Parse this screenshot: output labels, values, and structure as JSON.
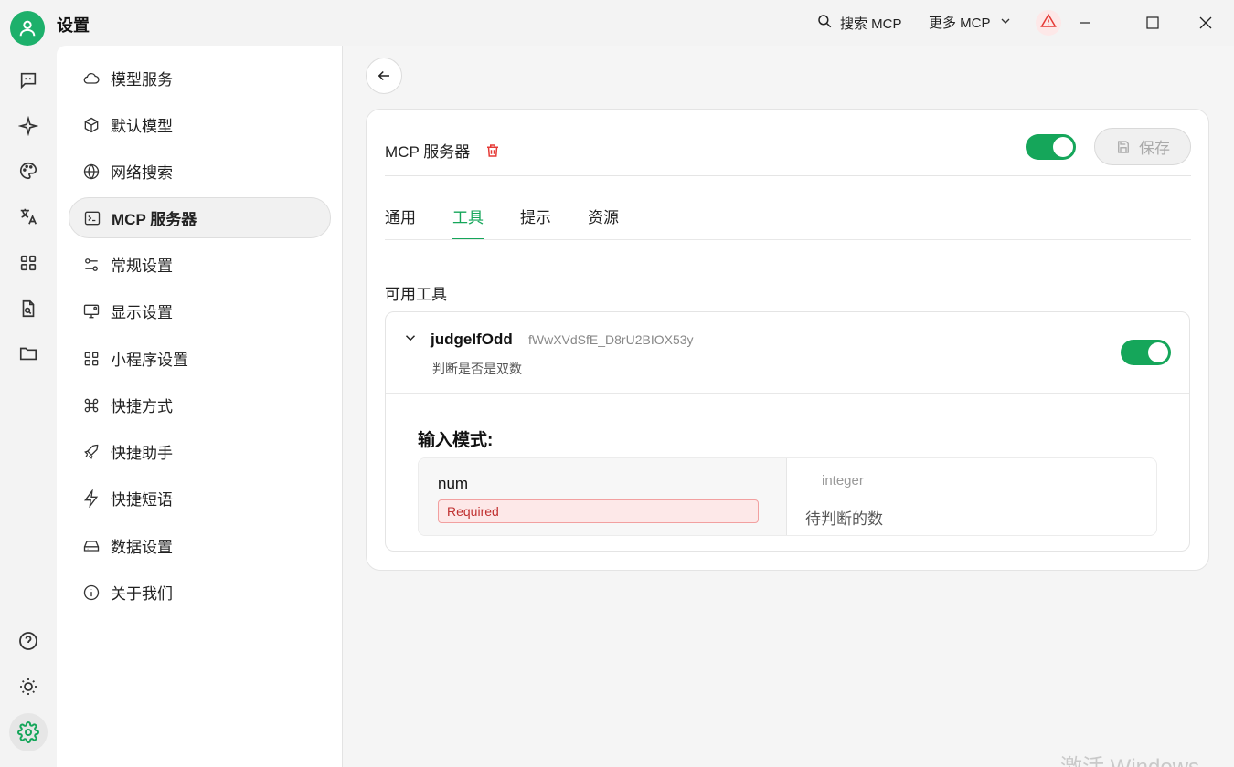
{
  "app": {
    "title": "设置"
  },
  "titlebar": {
    "search_label": "搜索 MCP",
    "more_label": "更多 MCP"
  },
  "nav": {
    "items": [
      {
        "label": "模型服务",
        "icon": "cloud-icon"
      },
      {
        "label": "默认模型",
        "icon": "cube-icon"
      },
      {
        "label": "网络搜索",
        "icon": "globe-icon"
      },
      {
        "label": "MCP 服务器",
        "icon": "terminal-icon",
        "active": true
      },
      {
        "label": "常规设置",
        "icon": "sliders-icon"
      },
      {
        "label": "显示设置",
        "icon": "monitor-icon"
      },
      {
        "label": "小程序设置",
        "icon": "grid-icon"
      },
      {
        "label": "快捷方式",
        "icon": "command-icon"
      },
      {
        "label": "快捷助手",
        "icon": "rocket-icon"
      },
      {
        "label": "快捷短语",
        "icon": "zap-icon"
      },
      {
        "label": "数据设置",
        "icon": "hard-drive-icon"
      },
      {
        "label": "关于我们",
        "icon": "info-icon"
      }
    ]
  },
  "server": {
    "title": "MCP 服务器",
    "save_label": "保存",
    "enabled": true
  },
  "tabs": [
    {
      "label": "通用"
    },
    {
      "label": "工具",
      "active": true
    },
    {
      "label": "提示"
    },
    {
      "label": "资源"
    }
  ],
  "tools_section": {
    "title": "可用工具"
  },
  "tool": {
    "name": "judgeIfOdd",
    "id": "fWwXVdSfE_D8rU2BIOX53y",
    "description": "判断是否是双数",
    "enabled": true,
    "schema_title": "输入模式:",
    "param": {
      "name": "num",
      "required_label": "Required",
      "type": "integer",
      "description": "待判断的数"
    }
  },
  "watermark": "激活 Windows",
  "colors": {
    "accent": "#15a65a",
    "danger": "#e53935",
    "avatar": "#1db06b"
  }
}
